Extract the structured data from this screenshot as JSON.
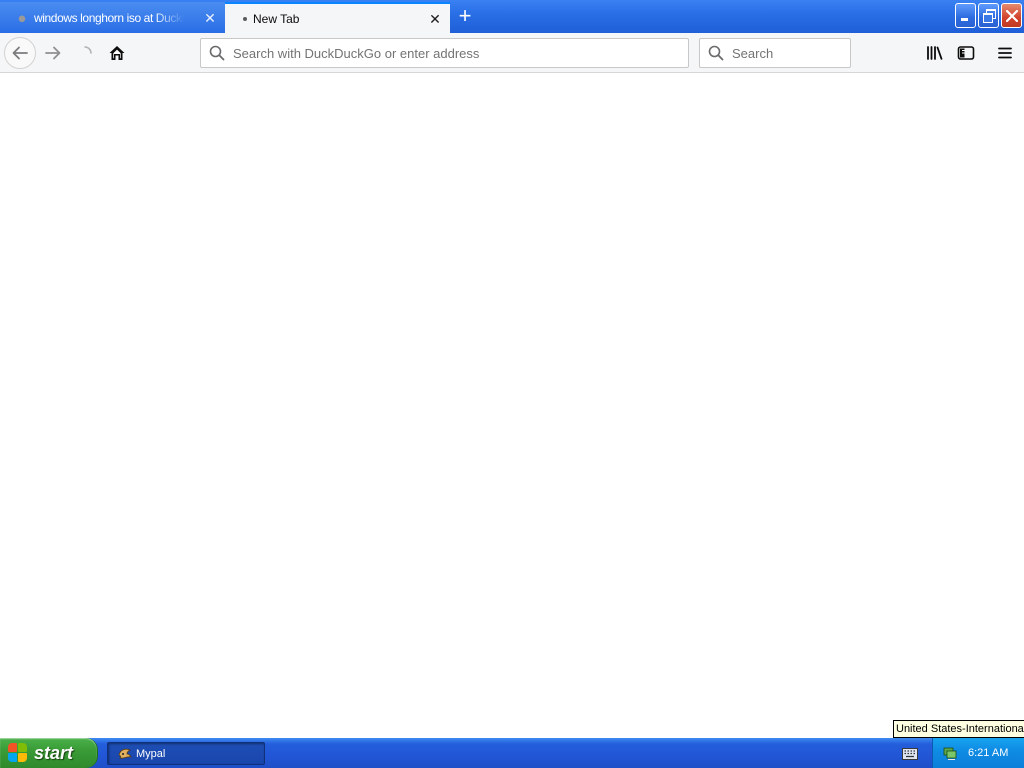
{
  "browser": {
    "tabs": [
      {
        "title": "windows longhorn iso at DuckDuckGo",
        "active": false
      },
      {
        "title": "New Tab",
        "active": true
      }
    ],
    "new_tab_symbol": "+",
    "close_symbol": "✕",
    "urlbar": {
      "placeholder": "Search with DuckDuckGo or enter address",
      "value": ""
    },
    "searchbar": {
      "placeholder": "Search",
      "value": ""
    },
    "toolbar_icons": [
      "back-arrow-icon",
      "forward-arrow-icon",
      "reload-icon",
      "home-icon",
      "library-icon",
      "sidebar-icon",
      "hamburger-menu-icon"
    ]
  },
  "window_controls": [
    "minimize",
    "restore",
    "close"
  ],
  "taskbar": {
    "start_label": "start",
    "tasks": [
      {
        "label": "Mypal",
        "icon": "mypal-icon"
      }
    ],
    "clock": "6:21 AM",
    "tray_icons": [
      "keyboard-icon",
      "network-icon"
    ]
  },
  "tooltip": {
    "text": "United States-International"
  },
  "colors": {
    "titlebar_blue": "#2a6fe6",
    "active_tab_accent": "#0a84ff",
    "toolbar_bg": "#f5f6f7",
    "taskbar_blue": "#245edb",
    "start_green": "#3a9c37",
    "tray_blue": "#0f8ce4",
    "tooltip_bg": "#ffffe1"
  }
}
